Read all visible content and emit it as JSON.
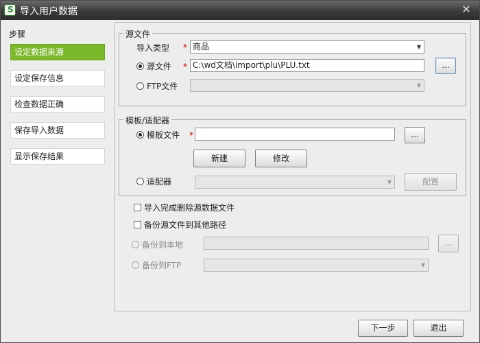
{
  "window": {
    "title": "导入用户数据",
    "close_glyph": "✕"
  },
  "steps": {
    "heading": "步骤",
    "items": [
      {
        "label": "设定数据来源",
        "active": true
      },
      {
        "label": "设定保存信息",
        "active": false
      },
      {
        "label": "检查数据正确",
        "active": false
      },
      {
        "label": "保存导入数据",
        "active": false
      },
      {
        "label": "显示保存结果",
        "active": false
      }
    ]
  },
  "source": {
    "group_title": "源文件",
    "import_type_label": "导入类型",
    "required_mark": "*",
    "import_type_value": "商品",
    "source_file_label": "源文件",
    "source_file_value": "C:\\wd文档\\import\\plu\\PLU.txt",
    "ftp_label": "FTP文件",
    "ftp_value": "",
    "browse_label": "...",
    "dropdown_arrow": "▼"
  },
  "template": {
    "group_title": "模板/适配器",
    "template_file_label": "模板文件",
    "template_file_value": "",
    "browse_label": "...",
    "new_label": "新建",
    "edit_label": "修改",
    "adapter_label": "适配器",
    "adapter_value": "",
    "config_label": "配置"
  },
  "options": {
    "delete_after_import": "导入完成删除源数据文件",
    "backup_other_path": "备份源文件到其他路径",
    "backup_local": "备份到本地",
    "backup_local_value": "",
    "backup_ftp": "备份到FTP",
    "backup_ftp_value": "",
    "browse_label": "..."
  },
  "footer": {
    "next_label": "下一步",
    "exit_label": "退出"
  }
}
